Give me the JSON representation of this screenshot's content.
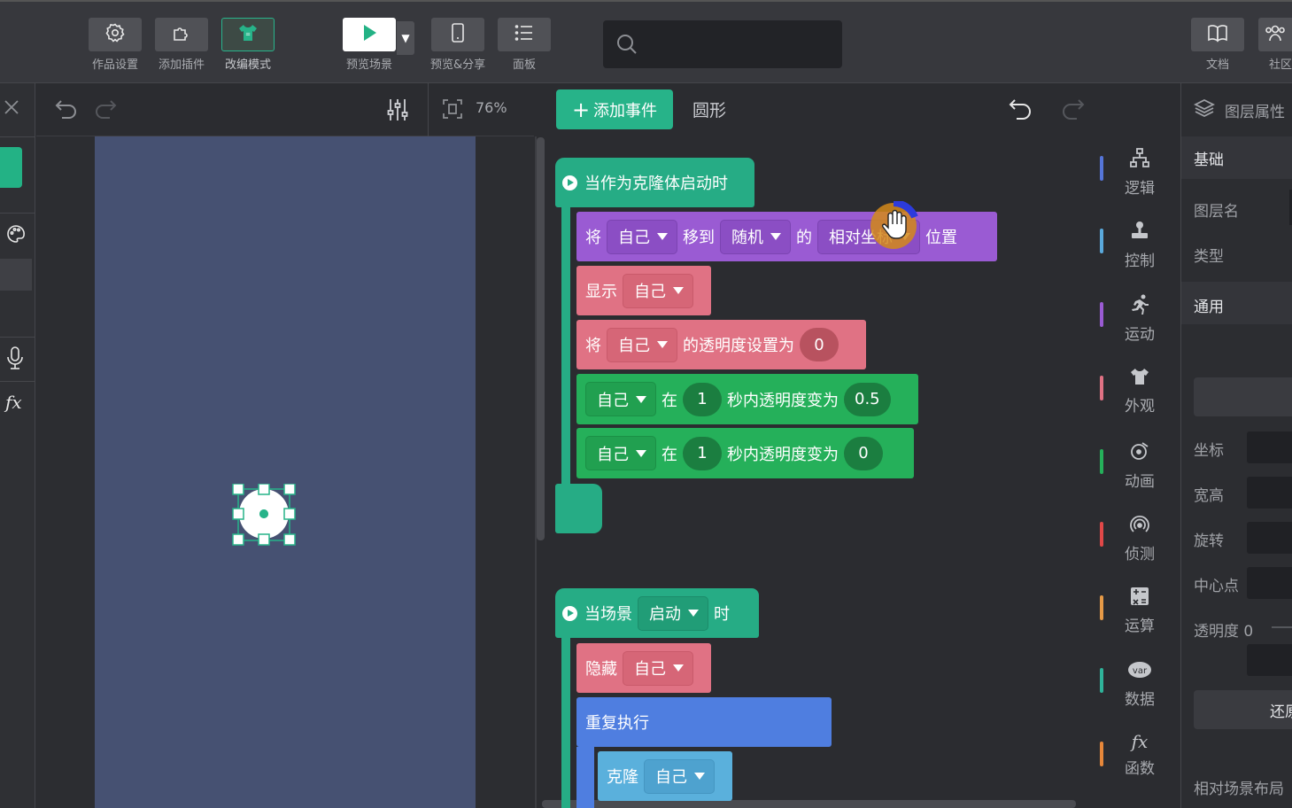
{
  "toolbar": {
    "project_settings": "作品设置",
    "add_plugin": "添加插件",
    "edit_mode": "改编模式",
    "preview_scene": "预览场景",
    "preview_share": "预览&分享",
    "panel": "面板",
    "search_placeholder": "",
    "docs": "文档",
    "community": "社区"
  },
  "stage": {
    "zoom": "76%"
  },
  "editor": {
    "add_event": "添加事件",
    "shape_name": "圆形"
  },
  "blocks": {
    "clone_start": "当作为克隆体启动时",
    "move_to": "将",
    "self": "自己",
    "move_word": "移到",
    "random": "随机",
    "of": "的",
    "relative_coord": "相对坐标",
    "position": "位置",
    "show": "显示",
    "set_opacity_prefix": "将",
    "set_opacity_word": "的透明度设置为",
    "opacity_zero": "0",
    "at": "在",
    "one": "1",
    "fade_word": "秒内透明度变为",
    "fade_half": "0.5",
    "fade_zero": "0",
    "scene_start_prefix": "当场景",
    "scene_start_dd": "启动",
    "scene_start_suffix": "时",
    "hide": "隐藏",
    "repeat": "重复执行",
    "clone": "克隆"
  },
  "categories": [
    {
      "label": "逻辑",
      "color": "#5575d8"
    },
    {
      "label": "控制",
      "color": "#5aa9dc"
    },
    {
      "label": "运动",
      "color": "#9a5bd3"
    },
    {
      "label": "外观",
      "color": "#e07284"
    },
    {
      "label": "动画",
      "color": "#25b05a"
    },
    {
      "label": "侦测",
      "color": "#e04848"
    },
    {
      "label": "运算",
      "color": "#e69a47"
    },
    {
      "label": "数据",
      "color": "#2fb39a"
    },
    {
      "label": "函数",
      "color": "#e6873a"
    }
  ],
  "props": {
    "header": "图层属性",
    "basic": "基础",
    "layer_name": "图层名",
    "type": "类型",
    "general": "通用",
    "coords": "坐标",
    "size": "宽高",
    "rotation": "旋转",
    "center": "中心点",
    "opacity": "透明度 0",
    "restore": "还原",
    "relative_layout": "相对场景布局"
  }
}
